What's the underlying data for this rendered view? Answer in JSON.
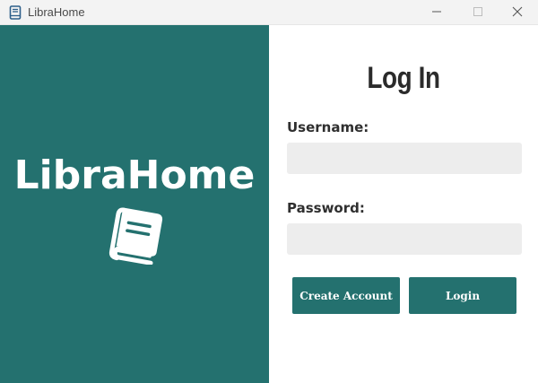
{
  "window": {
    "title": "LibraHome",
    "controls": [
      "minimize-icon",
      "maximize-icon",
      "close-icon"
    ]
  },
  "brand": {
    "name": "LibraHome",
    "icon": "book-icon",
    "panel_color": "#24716f"
  },
  "login": {
    "heading": "Log In",
    "username_label": "Username:",
    "username_value": "",
    "password_label": "Password:",
    "password_value": "",
    "create_account_label": "Create Account",
    "login_label": "Login",
    "button_color": "#24716f",
    "input_background": "#ededed"
  }
}
